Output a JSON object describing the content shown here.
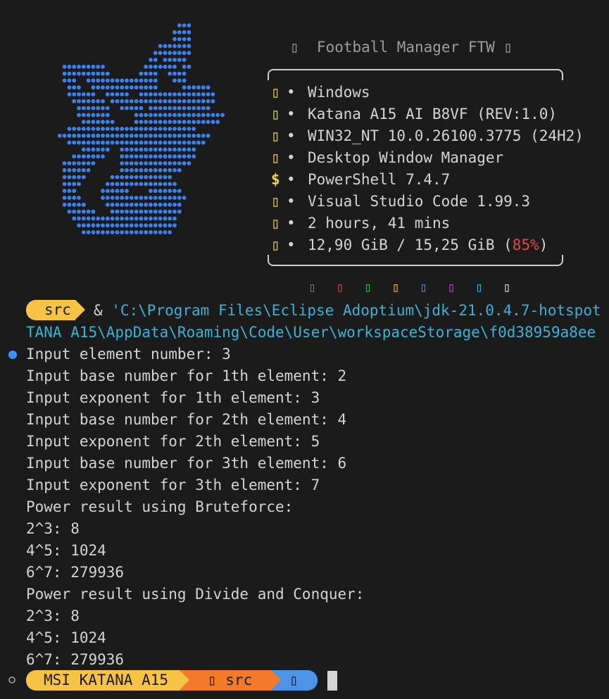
{
  "info": {
    "title": "▯  Football Manager FTW ▯",
    "rows": [
      {
        "icon": "▯",
        "text": "Windows"
      },
      {
        "icon": "▯",
        "text": "Katana A15 AI B8VF (REV:1.0)"
      },
      {
        "icon": "▯",
        "text": "WIN32_NT 10.0.26100.3775 (24H2)"
      },
      {
        "icon": "▯",
        "text": "Desktop Window Manager"
      },
      {
        "icon": "$",
        "text": "PowerShell 7.4.7"
      },
      {
        "icon": "▯",
        "text": "Visual Studio Code 1.99.3"
      },
      {
        "icon": "▯",
        "text": "2 hours, 41 mins"
      }
    ],
    "memory": {
      "icon": "▯",
      "used": "12,90 GiB / 15,25 GiB (",
      "percent": "85%",
      "close": ")"
    },
    "bullet": "•"
  },
  "palette": {
    "glyph": "▯",
    "colors": [
      "#7a7a7a",
      "#e5474b",
      "#3fb950",
      "#f2d43a",
      "#3794ff",
      "#c54fd6",
      "#3bb2d6",
      "#e8e8e8"
    ]
  },
  "command": {
    "dir_badge": "src",
    "amp": "& ",
    "line1": "'C:\\Program Files\\Eclipse Adoptium\\jdk-21.0.4.7-hotspot",
    "line2": "TANA A15\\AppData\\Roaming\\Code\\User\\workspaceStorage\\f0d38959a8ee"
  },
  "output": [
    "Input element number: 3",
    "Input base number for 1th element: 2",
    "Input exponent for 1th element: 3",
    "Input base number for 2th element: 4",
    "Input exponent for 2th element: 5",
    "Input base number for 3th element: 6",
    "Input exponent for 3th element: 7",
    "Power result using Bruteforce:",
    "2^3: 8",
    "4^5: 1024",
    "6^7: 279936",
    "Power result using Divide and Conquer:",
    "2^3: 8",
    "4^5: 1024",
    "6^7: 279936"
  ],
  "prompt": {
    "host": "MSI KATANA A15",
    "dir": "▯ src",
    "git": "▯"
  },
  "colors": {
    "background": "#1b1b1b",
    "art_dots": "#3b82f0",
    "accent_yellow": "#f6c344",
    "accent_orange": "#f5792a",
    "accent_blue": "#4f93e8",
    "string_cyan": "#3bb2d6"
  }
}
